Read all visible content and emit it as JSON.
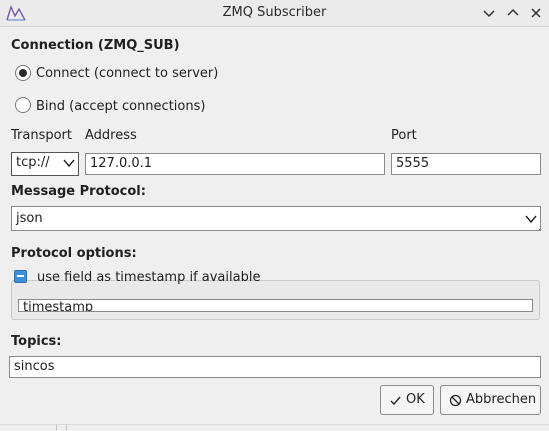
{
  "window": {
    "title": "ZMQ Subscriber"
  },
  "connection": {
    "heading": "Connection (ZMQ_SUB)",
    "connect_label": "Connect (connect to server)",
    "bind_label": "Bind (accept connections)",
    "connect_selected": true
  },
  "transport": {
    "label": "Transport",
    "value": "tcp://"
  },
  "address": {
    "label": "Address",
    "value": "127.0.0.1"
  },
  "port": {
    "label": "Port",
    "value": "5555"
  },
  "protocol": {
    "label": "Message Protocol:",
    "value": "json"
  },
  "options": {
    "label": "Protocol options:",
    "timestamp_checkbox_label": "use field as timestamp if available",
    "timestamp_field_value": "timestamp"
  },
  "topics": {
    "label": "Topics:",
    "value": "sincos"
  },
  "buttons": {
    "ok_label": "OK",
    "cancel_label": "Abbrechen"
  },
  "colors": {
    "accent": "#3c8fd8",
    "background": "#efefef"
  }
}
